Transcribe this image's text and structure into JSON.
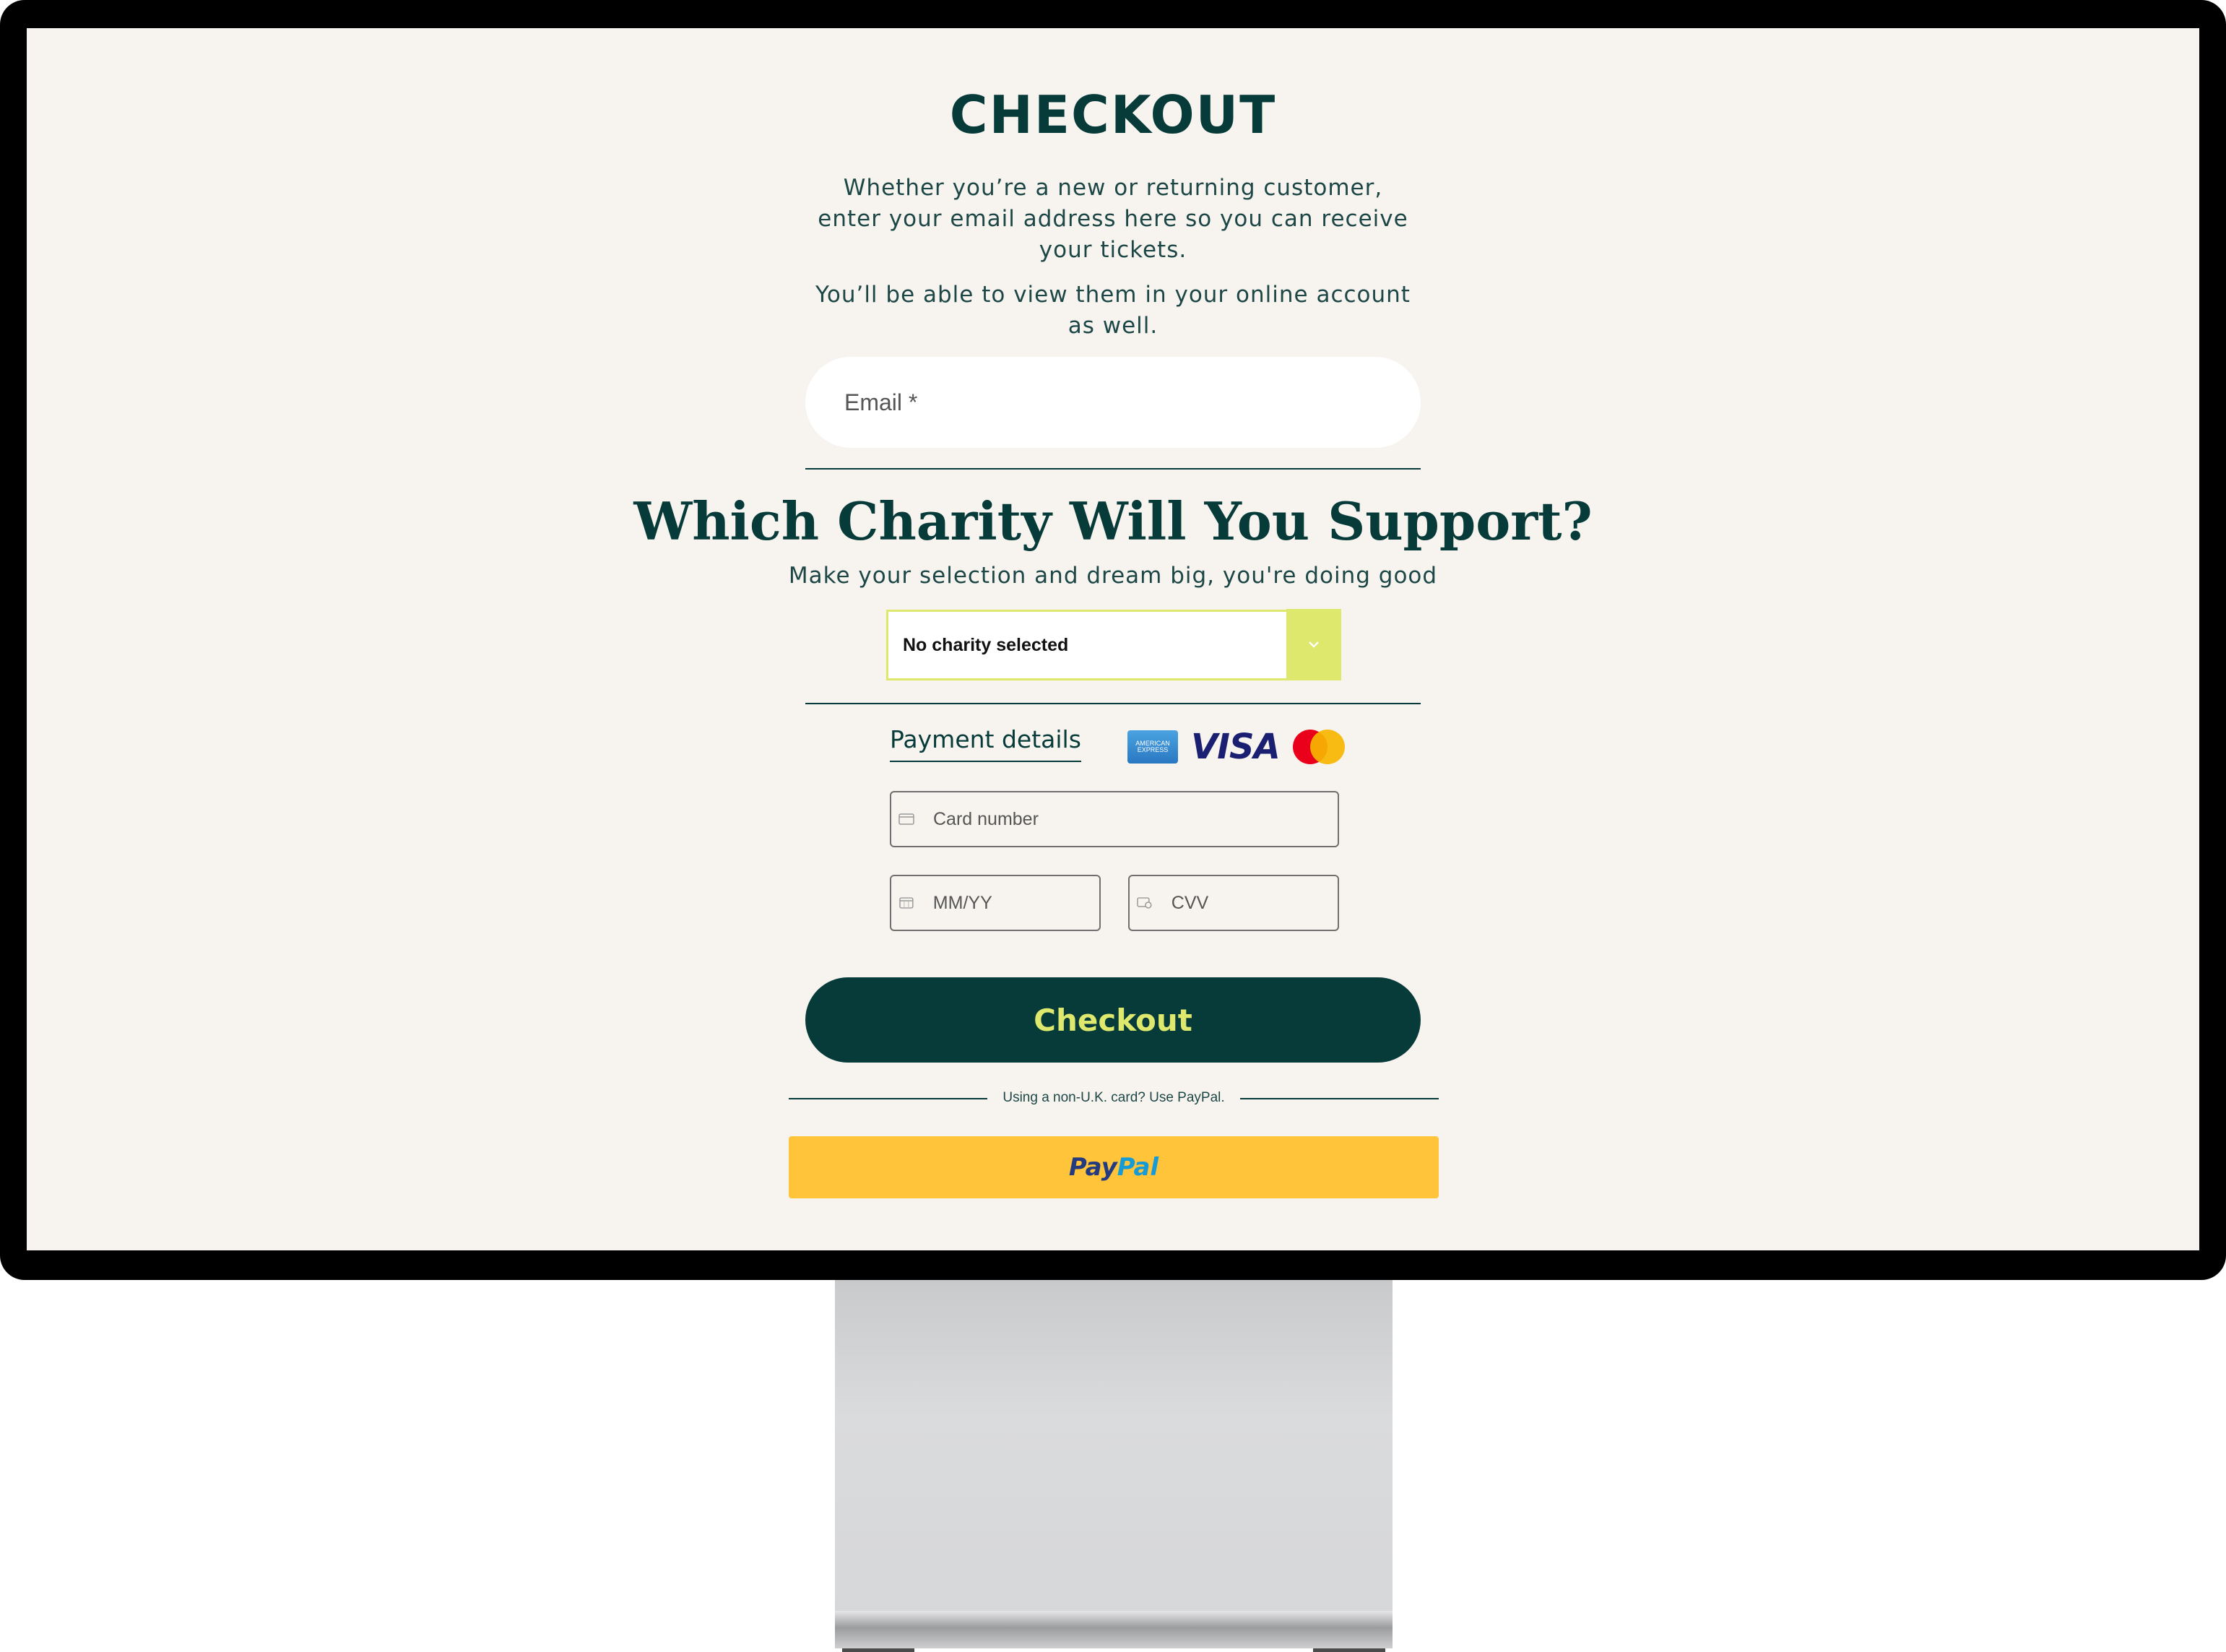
{
  "checkout": {
    "title": "CHECKOUT",
    "intro_line1": "Whether you’re a new or returning customer, enter your email address here so you can receive your tickets.",
    "intro_line2": "You’ll be able to view them in your online account as well.",
    "email_placeholder": "Email *"
  },
  "charity": {
    "title": "Which Charity Will You Support?",
    "subtitle": "Make your selection and dream big, you're doing good",
    "selected": "No charity selected"
  },
  "payment": {
    "tab_label": "Payment details",
    "card_brands": [
      "AMERICAN EXPRESS",
      "VISA",
      "mastercard"
    ],
    "card_number_placeholder": "Card number",
    "expiry_placeholder": "MM/YY",
    "cvv_placeholder": "CVV",
    "checkout_label": "Checkout",
    "alt_text": "Using a non-U.K. card? Use PayPal.",
    "paypal_part1": "Pay",
    "paypal_part2": "Pal"
  },
  "colors": {
    "primary": "#073b3a",
    "accent": "#dde86c",
    "background": "#f7f4ef",
    "paypal": "#ffc439"
  }
}
